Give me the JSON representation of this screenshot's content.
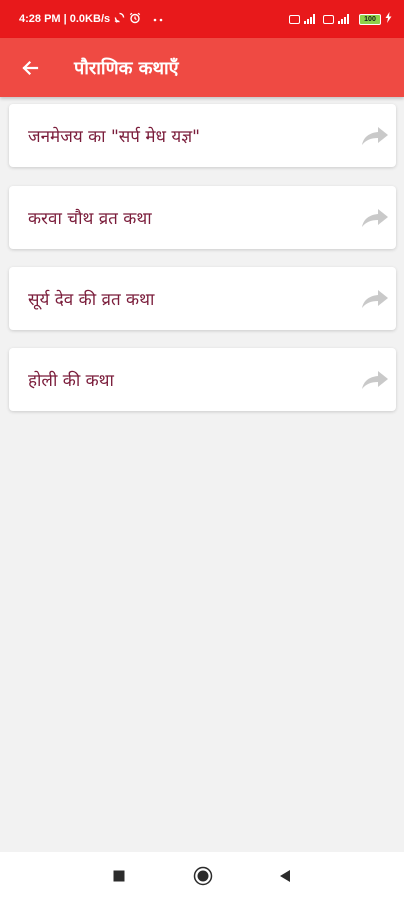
{
  "status_bar": {
    "time_info": "4:28 PM | 0.0KB/s",
    "battery_level": "100",
    "background_color": "#e8191b",
    "icons": [
      "sync-icon",
      "alarm-icon",
      "more-dots-icon",
      "volte-icon",
      "signal-icon",
      "volte-icon",
      "signal-icon",
      "battery-icon",
      "charging-icon"
    ]
  },
  "app_bar": {
    "title": "पौराणिक कथाएँ",
    "back_icon": "back-arrow-icon",
    "background_color": "#ef4a43"
  },
  "stories": [
    {
      "title": "जनमेजय का \"सर्प मेध यज्ञ\"",
      "icon": "share-arrow-icon"
    },
    {
      "title": "करवा चौथ व्रत कथा",
      "icon": "share-arrow-icon"
    },
    {
      "title": "सूर्य देव की व्रत कथा",
      "icon": "share-arrow-icon"
    },
    {
      "title": "होली की कथा",
      "icon": "share-arrow-icon"
    }
  ],
  "colors": {
    "story_text": "#7a1c3a",
    "share_icon": "#c9c9c9",
    "background": "#f2f2f2"
  },
  "nav_bar": {
    "buttons": [
      "recents-square-icon",
      "home-circle-icon",
      "back-triangle-icon"
    ]
  }
}
